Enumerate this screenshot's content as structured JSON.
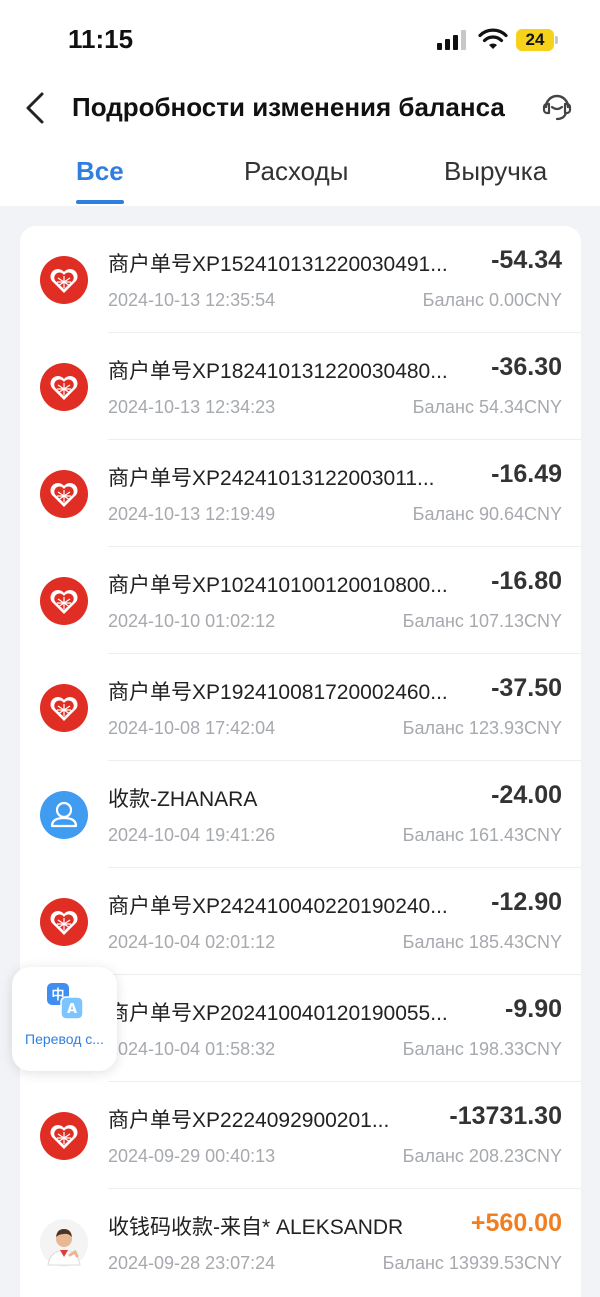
{
  "status_bar": {
    "time": "11:15",
    "battery": "24"
  },
  "nav": {
    "title": "Подробности изменения баланса"
  },
  "tabs": [
    {
      "label": "Все",
      "active": true
    },
    {
      "label": "Расходы",
      "active": false
    },
    {
      "label": "Выручка",
      "active": false
    }
  ],
  "colors": {
    "accent": "#2f7fe0",
    "positive_amount": "#f07f22",
    "merchant_red": "#e02e24",
    "user_blue": "#3f9cf0"
  },
  "transactions": [
    {
      "icon": "merchant-heart-icon",
      "title": "商户单号XP152410131220030491...",
      "amount": "-54.34",
      "date": "2024-10-13 12:35:54",
      "balance": "Баланс 0.00CNY"
    },
    {
      "icon": "merchant-heart-icon",
      "title": "商户单号XP182410131220030480...",
      "amount": "-36.30",
      "date": "2024-10-13 12:34:23",
      "balance": "Баланс 54.34CNY"
    },
    {
      "icon": "merchant-heart-icon",
      "title": "商户单号XP24241013122003011...",
      "amount": "-16.49",
      "date": "2024-10-13 12:19:49",
      "balance": "Баланс 90.64CNY"
    },
    {
      "icon": "merchant-heart-icon",
      "title": "商户单号XP102410100120010800...",
      "amount": "-16.80",
      "date": "2024-10-10 01:02:12",
      "balance": "Баланс 107.13CNY"
    },
    {
      "icon": "merchant-heart-icon",
      "title": "商户单号XP192410081720002460...",
      "amount": "-37.50",
      "date": "2024-10-08 17:42:04",
      "balance": "Баланс 123.93CNY"
    },
    {
      "icon": "user-avatar-icon",
      "title": "收款-ZHANARA",
      "amount": "-24.00",
      "date": "2024-10-04 19:41:26",
      "balance": "Баланс 161.43CNY"
    },
    {
      "icon": "merchant-heart-icon",
      "title": "商户单号XP242410040220190240...",
      "amount": "-12.90",
      "date": "2024-10-04 02:01:12",
      "balance": "Баланс 185.43CNY"
    },
    {
      "icon": "merchant-heart-icon",
      "title": "商户单号XP202410040120190055...",
      "amount": "-9.90",
      "date": "2024-10-04 01:58:32",
      "balance": "Баланс 198.33CNY"
    },
    {
      "icon": "merchant-heart-icon",
      "title": "商户单号XP2224092900201...",
      "amount": "-13731.30",
      "date": "2024-09-29 00:40:13",
      "balance": "Баланс 208.23CNY"
    },
    {
      "icon": "person-photo-icon",
      "title": "收钱码收款-来自* ALEKSANDR",
      "amount": "+560.00",
      "date": "2024-09-28 23:07:24",
      "balance": "Баланс 13939.53CNY"
    }
  ],
  "translate_widget": {
    "label": "Перевод с..."
  }
}
